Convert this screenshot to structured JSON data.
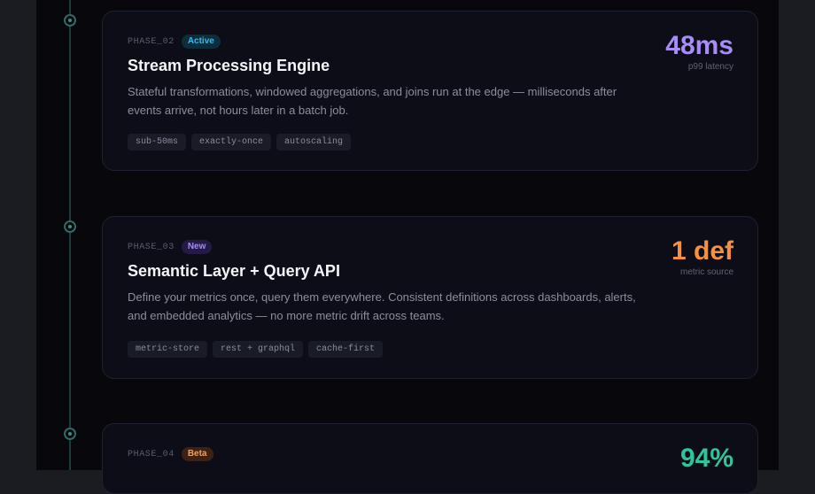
{
  "phases": [
    {
      "id": "PHASE_02",
      "badge": "Active",
      "title": "Stream Processing Engine",
      "description": "Stateful transformations, windowed aggregations, and joins run at the edge — milliseconds after events arrive, not hours later in a batch job.",
      "tags": [
        "sub-50ms",
        "exactly-once",
        "autoscaling"
      ],
      "metric_value": "48ms",
      "metric_label": "p99 latency",
      "metric_color": "#a88cf8"
    },
    {
      "id": "PHASE_03",
      "badge": "New",
      "title": "Semantic Layer + Query API",
      "description": "Define your metrics once, query them everywhere. Consistent definitions across dashboards, alerts, and embedded analytics — no more metric drift across teams.",
      "tags": [
        "metric-store",
        "rest + graphql",
        "cache-first"
      ],
      "metric_value": "1 def",
      "metric_label": "metric source",
      "metric_color": "#f4913f"
    },
    {
      "id": "PHASE_04",
      "badge": "Beta",
      "metric_value": "94%",
      "metric_color": "#2fc59a"
    }
  ]
}
